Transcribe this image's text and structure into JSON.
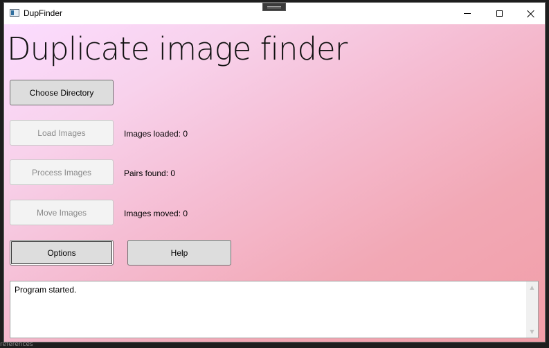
{
  "window": {
    "title": "DupFinder"
  },
  "main": {
    "heading": "Duplicate image finder",
    "choose_directory_label": "Choose Directory",
    "load_images_label": "Load Images",
    "process_images_label": "Process Images",
    "move_images_label": "Move Images",
    "options_label": "Options",
    "help_label": "Help",
    "images_loaded_text": "Images loaded: 0",
    "pairs_found_text": "Pairs found: 0",
    "images_moved_text": "Images moved: 0"
  },
  "log": {
    "text": "Program started."
  },
  "background": {
    "status_text": "references"
  },
  "icons": {
    "scroll_up": "scroll-up-arrow",
    "scroll_down": "scroll-down-arrow"
  },
  "colors": {
    "gradient_start": "#fbdcff",
    "gradient_end": "#f19ea8",
    "button_bg": "#dddddd",
    "disabled_text": "#8a8a8a"
  }
}
